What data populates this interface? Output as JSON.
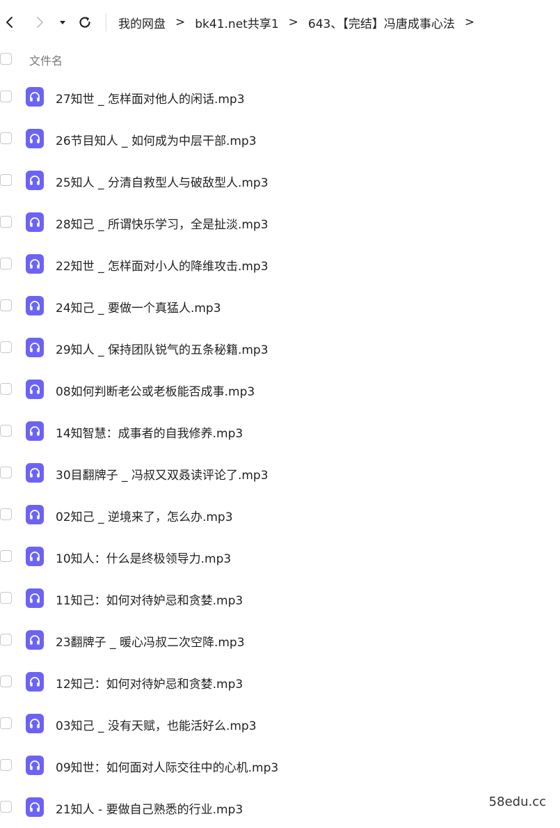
{
  "toolbar": {
    "back_icon": "chevron-left-icon",
    "forward_icon": "chevron-right-icon",
    "dropdown_icon": "caret-down-icon",
    "refresh_icon": "refresh-icon"
  },
  "breadcrumb": {
    "items": [
      "我的网盘",
      "bk41.net共享1",
      "643、【完结】冯唐成事心法"
    ],
    "separator": ">"
  },
  "list_header": {
    "label": "文件名"
  },
  "file_icon": "headphones-icon",
  "files": [
    "27知世 _ 怎样面对他人的闲话.mp3",
    "26节目知人 _ 如何成为中层干部.mp3",
    "25知人 _ 分清自救型人与破敌型人.mp3",
    "28知己 _ 所谓快乐学习，全是扯淡.mp3",
    "22知世 _ 怎样面对小人的降维攻击.mp3",
    "24知己 _ 要做一个真猛人.mp3",
    "29知人 _ 保持团队锐气的五条秘籍.mp3",
    "08如何判断老公或老板能否成事.mp3",
    "14知智慧：成事者的自我修养.mp3",
    "30目翻牌子 _ 冯叔又双叒读评论了.mp3",
    "02知己 _ 逆境来了，怎么办.mp3",
    "10知人：什么是终极领导力.mp3",
    "11知己：如何对待妒忌和贪婪.mp3",
    "23翻牌子 _ 暖心冯叔二次空降.mp3",
    "12知己：如何对待妒忌和贪婪.mp3",
    "03知己 _ 没有天赋，也能活好么.mp3",
    "09知世：如何面对人际交往中的心机.mp3",
    "21知人 - 要做自己熟悉的行业.mp3"
  ],
  "watermark": "58edu.cc",
  "colors": {
    "file_icon_bg": "#6c63f5"
  }
}
